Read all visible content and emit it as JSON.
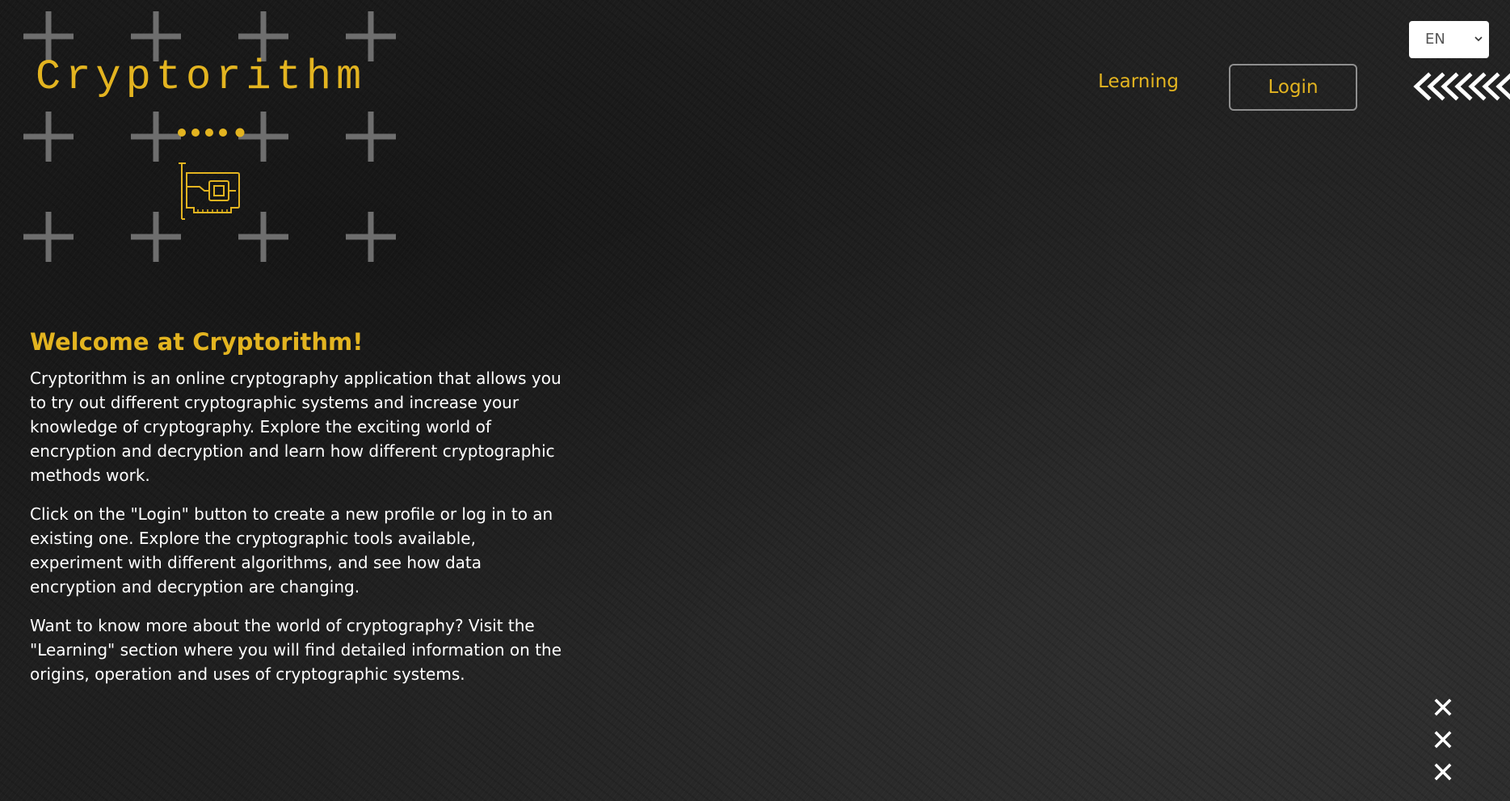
{
  "app": {
    "name": "Cryptorithm"
  },
  "logo": {
    "text": "Cryptorithm",
    "icon": "circuit-card-icon"
  },
  "nav": {
    "learning_label": "Learning",
    "login_label": "Login"
  },
  "language": {
    "selected": "EN",
    "icon": "chevron-down-icon"
  },
  "decor": {
    "arrows_icon": "double-chevron-left-icon",
    "x_icon": "close-icon",
    "x_count": 3
  },
  "main": {
    "title": "Welcome at Cryptorithm!",
    "paragraphs": [
      "Cryptorithm is an online cryptography application that allows you to try out different cryptographic systems and increase your knowledge of cryptography. Explore the exciting world of encryption and decryption and learn how different cryptographic methods work.",
      "Click on the \"Login\" button to create a new profile or log in to an existing one. Explore the cryptographic tools available, experiment with different algorithms, and see how data encryption and decryption are changing.",
      "Want to know more about the world of cryptography? Visit the \"Learning\" section where you will find detailed information on the origins, operation and uses of cryptographic systems."
    ]
  },
  "colors": {
    "accent": "#e3b420",
    "background": "#1f1f1f",
    "text": "#ffffff",
    "plus_marks": "#6e6e6e",
    "button_border": "#8f8f8f"
  }
}
